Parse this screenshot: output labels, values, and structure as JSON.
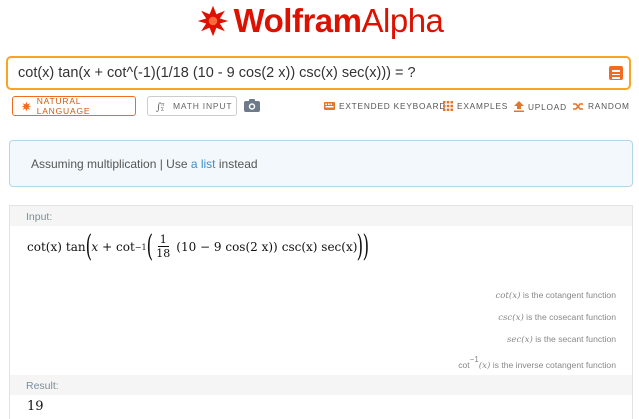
{
  "logo": {
    "brand_bold": "Wolfram",
    "brand_light": "Alpha"
  },
  "search": {
    "query": "cot(x) tan(x + cot^(-1)(1/18 (10 - 9 cos(2 x)) csc(x) sec(x))) = ?"
  },
  "toolbar": {
    "natural_language": "NATURAL LANGUAGE",
    "math_input": "MATH INPUT",
    "extended_keyboard": "EXTENDED KEYBOARD",
    "examples": "EXAMPLES",
    "upload": "UPLOAD",
    "random": "RANDOM"
  },
  "assumption": {
    "text_before": "Assuming multiplication | Use ",
    "link_text": "a list",
    "text_after": " instead"
  },
  "input_pod": {
    "title": "Input:",
    "formula": {
      "cot": "cot(x)",
      "tan": "tan",
      "x": "x",
      "plus_cot": "+ cot",
      "inv": "−1",
      "frac_num": "1",
      "frac_den": "18",
      "inner": "(10 − 9 cos(2 x))",
      "tail": "csc(x) sec(x)"
    },
    "notes": [
      {
        "fn": "cot(x)",
        "text": " is the cotangent function"
      },
      {
        "fn": "csc(x)",
        "text": " is the cosecant function"
      },
      {
        "fn": "sec(x)",
        "text": " is the secant function"
      },
      {
        "fn": "cot",
        "sup": "−1",
        "fn_arg": "(x)",
        "text": " is the inverse cotangent function"
      }
    ]
  },
  "result_pod": {
    "title": "Result:",
    "value": "19"
  },
  "colors": {
    "brand": "#dd1100",
    "search_border": "#f6a623",
    "accent": "#f36b21",
    "link": "#3b91c7"
  }
}
